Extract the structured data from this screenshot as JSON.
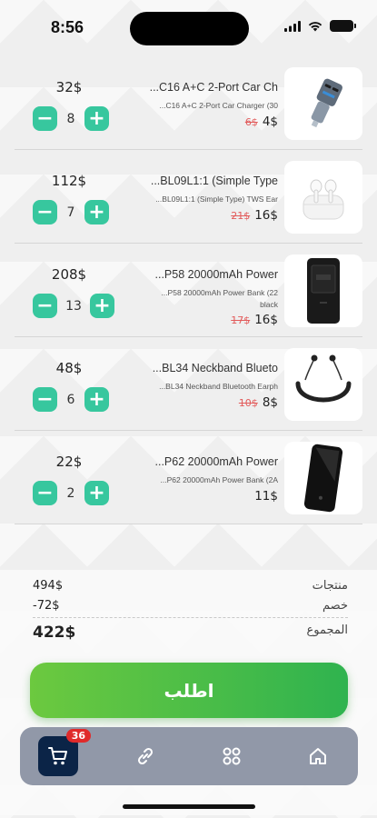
{
  "status_bar": {
    "time": "8:56"
  },
  "cart_items": [
    {
      "subtotal": "32$",
      "quantity": "8",
      "title": "...C16 A+C 2-Port Car Ch",
      "description": "...C16 A+C 2-Port Car Charger (30",
      "price": "4$",
      "old_price": "6$",
      "image_icon": "car-charger-icon"
    },
    {
      "subtotal": "112$",
      "quantity": "7",
      "title": "...BL09L1:1 (Simple Type",
      "description": "...BL09L1:1 (Simple Type) TWS Ear",
      "price": "16$",
      "old_price": "21$",
      "image_icon": "earbuds-icon"
    },
    {
      "subtotal": "208$",
      "quantity": "13",
      "title": "...P58 20000mAh Power",
      "description": "...P58 20000mAh Power Bank (22",
      "description2": "black",
      "price": "16$",
      "old_price": "17$",
      "image_icon": "power-bank-icon"
    },
    {
      "subtotal": "48$",
      "quantity": "6",
      "title": "...BL34 Neckband Blueto",
      "description": "...BL34 Neckband Bluetooth Earph",
      "price": "8$",
      "old_price": "10$",
      "image_icon": "neckband-earphones-icon"
    },
    {
      "subtotal": "22$",
      "quantity": "2",
      "title": "...P62 20000mAh Power",
      "description": "...P62 20000mAh Power Bank (2A",
      "price": "11$",
      "old_price": "",
      "image_icon": "power-bank-icon"
    }
  ],
  "summary": {
    "products_label": "منتجات",
    "products_value": "494$",
    "discount_label": "خصم",
    "discount_value": "-72$",
    "total_label": "المجموع",
    "total_value": "422$"
  },
  "order_button": {
    "label": "اطلب"
  },
  "tab_bar": {
    "cart_badge": "36",
    "tabs": [
      "cart-icon",
      "link-icon",
      "grid-icon",
      "home-icon"
    ]
  },
  "colors": {
    "accent": "#37c79e",
    "order_gradient_start": "#6cc93f",
    "order_gradient_end": "#2fb34f",
    "tabbar_bg": "#9198a8",
    "tab_active_bg": "#0b2447",
    "old_price": "#e25b5b",
    "badge": "#e02a2a"
  }
}
